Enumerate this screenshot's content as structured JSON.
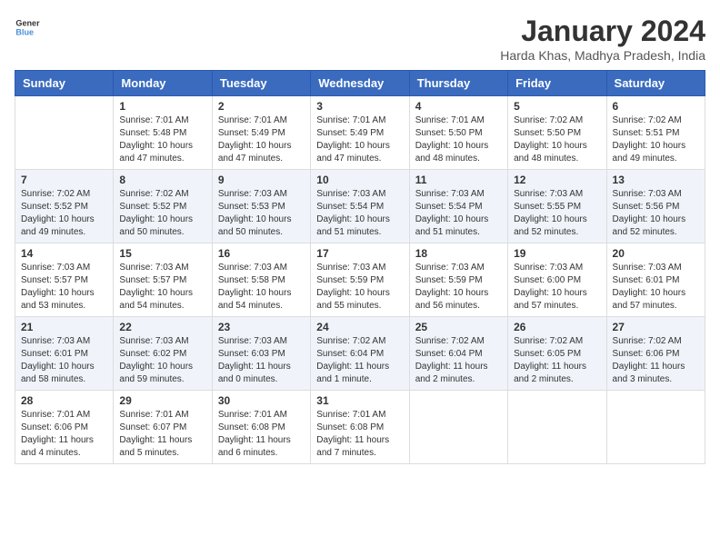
{
  "logo": {
    "line1": "General",
    "line2": "Blue"
  },
  "title": "January 2024",
  "subtitle": "Harda Khas, Madhya Pradesh, India",
  "headers": [
    "Sunday",
    "Monday",
    "Tuesday",
    "Wednesday",
    "Thursday",
    "Friday",
    "Saturday"
  ],
  "weeks": [
    [
      {
        "day": "",
        "info": ""
      },
      {
        "day": "1",
        "info": "Sunrise: 7:01 AM\nSunset: 5:48 PM\nDaylight: 10 hours\nand 47 minutes."
      },
      {
        "day": "2",
        "info": "Sunrise: 7:01 AM\nSunset: 5:49 PM\nDaylight: 10 hours\nand 47 minutes."
      },
      {
        "day": "3",
        "info": "Sunrise: 7:01 AM\nSunset: 5:49 PM\nDaylight: 10 hours\nand 47 minutes."
      },
      {
        "day": "4",
        "info": "Sunrise: 7:01 AM\nSunset: 5:50 PM\nDaylight: 10 hours\nand 48 minutes."
      },
      {
        "day": "5",
        "info": "Sunrise: 7:02 AM\nSunset: 5:50 PM\nDaylight: 10 hours\nand 48 minutes."
      },
      {
        "day": "6",
        "info": "Sunrise: 7:02 AM\nSunset: 5:51 PM\nDaylight: 10 hours\nand 49 minutes."
      }
    ],
    [
      {
        "day": "7",
        "info": "Sunrise: 7:02 AM\nSunset: 5:52 PM\nDaylight: 10 hours\nand 49 minutes."
      },
      {
        "day": "8",
        "info": "Sunrise: 7:02 AM\nSunset: 5:52 PM\nDaylight: 10 hours\nand 50 minutes."
      },
      {
        "day": "9",
        "info": "Sunrise: 7:03 AM\nSunset: 5:53 PM\nDaylight: 10 hours\nand 50 minutes."
      },
      {
        "day": "10",
        "info": "Sunrise: 7:03 AM\nSunset: 5:54 PM\nDaylight: 10 hours\nand 51 minutes."
      },
      {
        "day": "11",
        "info": "Sunrise: 7:03 AM\nSunset: 5:54 PM\nDaylight: 10 hours\nand 51 minutes."
      },
      {
        "day": "12",
        "info": "Sunrise: 7:03 AM\nSunset: 5:55 PM\nDaylight: 10 hours\nand 52 minutes."
      },
      {
        "day": "13",
        "info": "Sunrise: 7:03 AM\nSunset: 5:56 PM\nDaylight: 10 hours\nand 52 minutes."
      }
    ],
    [
      {
        "day": "14",
        "info": "Sunrise: 7:03 AM\nSunset: 5:57 PM\nDaylight: 10 hours\nand 53 minutes."
      },
      {
        "day": "15",
        "info": "Sunrise: 7:03 AM\nSunset: 5:57 PM\nDaylight: 10 hours\nand 54 minutes."
      },
      {
        "day": "16",
        "info": "Sunrise: 7:03 AM\nSunset: 5:58 PM\nDaylight: 10 hours\nand 54 minutes."
      },
      {
        "day": "17",
        "info": "Sunrise: 7:03 AM\nSunset: 5:59 PM\nDaylight: 10 hours\nand 55 minutes."
      },
      {
        "day": "18",
        "info": "Sunrise: 7:03 AM\nSunset: 5:59 PM\nDaylight: 10 hours\nand 56 minutes."
      },
      {
        "day": "19",
        "info": "Sunrise: 7:03 AM\nSunset: 6:00 PM\nDaylight: 10 hours\nand 57 minutes."
      },
      {
        "day": "20",
        "info": "Sunrise: 7:03 AM\nSunset: 6:01 PM\nDaylight: 10 hours\nand 57 minutes."
      }
    ],
    [
      {
        "day": "21",
        "info": "Sunrise: 7:03 AM\nSunset: 6:01 PM\nDaylight: 10 hours\nand 58 minutes."
      },
      {
        "day": "22",
        "info": "Sunrise: 7:03 AM\nSunset: 6:02 PM\nDaylight: 10 hours\nand 59 minutes."
      },
      {
        "day": "23",
        "info": "Sunrise: 7:03 AM\nSunset: 6:03 PM\nDaylight: 11 hours\nand 0 minutes."
      },
      {
        "day": "24",
        "info": "Sunrise: 7:02 AM\nSunset: 6:04 PM\nDaylight: 11 hours\nand 1 minute."
      },
      {
        "day": "25",
        "info": "Sunrise: 7:02 AM\nSunset: 6:04 PM\nDaylight: 11 hours\nand 2 minutes."
      },
      {
        "day": "26",
        "info": "Sunrise: 7:02 AM\nSunset: 6:05 PM\nDaylight: 11 hours\nand 2 minutes."
      },
      {
        "day": "27",
        "info": "Sunrise: 7:02 AM\nSunset: 6:06 PM\nDaylight: 11 hours\nand 3 minutes."
      }
    ],
    [
      {
        "day": "28",
        "info": "Sunrise: 7:01 AM\nSunset: 6:06 PM\nDaylight: 11 hours\nand 4 minutes."
      },
      {
        "day": "29",
        "info": "Sunrise: 7:01 AM\nSunset: 6:07 PM\nDaylight: 11 hours\nand 5 minutes."
      },
      {
        "day": "30",
        "info": "Sunrise: 7:01 AM\nSunset: 6:08 PM\nDaylight: 11 hours\nand 6 minutes."
      },
      {
        "day": "31",
        "info": "Sunrise: 7:01 AM\nSunset: 6:08 PM\nDaylight: 11 hours\nand 7 minutes."
      },
      {
        "day": "",
        "info": ""
      },
      {
        "day": "",
        "info": ""
      },
      {
        "day": "",
        "info": ""
      }
    ]
  ]
}
